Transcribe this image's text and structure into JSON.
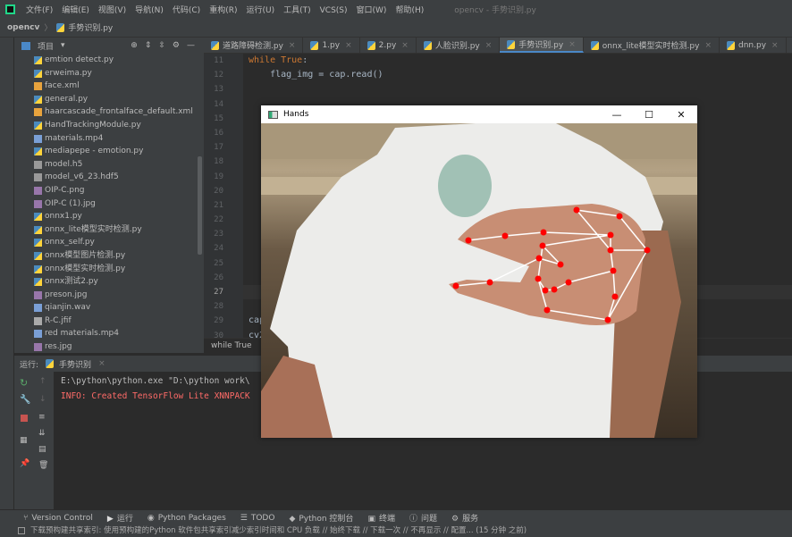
{
  "menubar": {
    "items": [
      "文件(F)",
      "编辑(E)",
      "视图(V)",
      "导航(N)",
      "代码(C)",
      "重构(R)",
      "运行(U)",
      "工具(T)",
      "VCS(S)",
      "窗口(W)",
      "帮助(H)"
    ],
    "title": "opencv - 手势识别.py"
  },
  "breadcrumb": {
    "project": "opencv",
    "file": "手势识别.py"
  },
  "project_panel": {
    "title": "项目",
    "files": [
      "emtion detect.py",
      "erweima.py",
      "face.xml",
      "general.py",
      "haarcascade_frontalface_default.xml",
      "HandTrackingModule.py",
      "materials.mp4",
      "mediapepe - emotion.py",
      "model.h5",
      "model_v6_23.hdf5",
      "OIP-C.png",
      "OIP-C (1).jpg",
      "onnx1.py",
      "onnx_lite模型实时检测.py",
      "onnx_self.py",
      "onnx模型图片检测.py",
      "onnx模型实时检测.py",
      "onnx测试2.py",
      "preson.jpg",
      "qianjin.wav",
      "R-C.jfif",
      "red materials.mp4",
      "res.jpg"
    ]
  },
  "tabs": [
    "道路障碍检测.py",
    "1.py",
    "2.py",
    "人脸识别.py",
    "手势识别.py",
    "onnx_lite模型实时检测.py",
    "dnn.py",
    "onnx"
  ],
  "active_tab": "手势识别.py",
  "editor": {
    "line_numbers": [
      "11",
      "12",
      "13",
      "14",
      "15",
      "16",
      "17",
      "18",
      "19",
      "20",
      "21",
      "22",
      "23",
      "24",
      "25",
      "26",
      "27",
      "28",
      "29",
      "30"
    ],
    "lines": [
      {
        "kw": "while True",
        "rest": ":"
      },
      {
        "kw": "",
        "rest": "    flag_img = cap.read()"
      },
      {
        "kw": "",
        "rest": ""
      },
      {
        "kw": "",
        "rest": ""
      },
      {
        "kw": "",
        "rest": ""
      },
      {
        "kw": "",
        "rest": ""
      },
      {
        "kw": "",
        "rest": ""
      },
      {
        "kw": "",
        "rest": ""
      },
      {
        "kw": "",
        "rest": ""
      },
      {
        "kw": "",
        "rest": ""
      },
      {
        "kw": "",
        "rest": ""
      },
      {
        "kw": "",
        "rest": ""
      },
      {
        "kw": "",
        "rest": ""
      },
      {
        "kw": "",
        "rest": ""
      },
      {
        "kw": "",
        "rest": ""
      },
      {
        "kw": "",
        "rest": ""
      },
      {
        "kw": "",
        "rest": ""
      },
      {
        "kw": "",
        "rest": ""
      },
      {
        "kw": "",
        "rest": "cap"
      },
      {
        "kw": "",
        "rest": "cv2"
      }
    ],
    "breadcrumb": "while True"
  },
  "run_panel": {
    "label": "运行:",
    "tab": "手势识别",
    "console": [
      "E:\\python\\python.exe \"D:\\python work\\",
      "INFO: Created TensorFlow Lite XNNPACK"
    ]
  },
  "hands_window": {
    "title": "Hands",
    "minimize": "—",
    "maximize": "☐",
    "close": "✕"
  },
  "bottom_toolbar": [
    "Version Control",
    "运行",
    "Python Packages",
    "TODO",
    "Python 控制台",
    "终端",
    "问题",
    "服务"
  ],
  "status": "下载预构建共享索引: 使用预构建的Python 软件包共享索引减少索引时间和 CPU 负载 // 始终下载 // 下载一次 // 不再显示 // 配置... (15 分钟 之前)",
  "colors": {
    "accent": "#4a88c7",
    "error_text": "#ff6b68",
    "keyword": "#cc7832",
    "landmark": "#ff0000"
  }
}
